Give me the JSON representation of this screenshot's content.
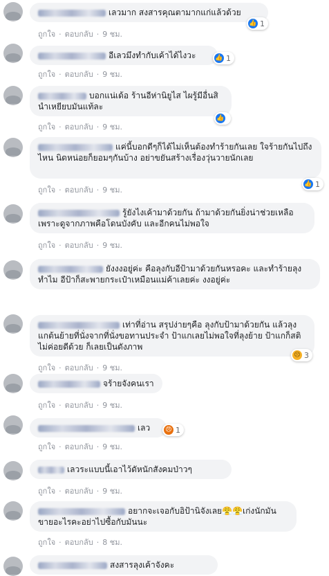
{
  "actions": {
    "like": "ถูกใจ",
    "reply": "ตอบกลับ",
    "sep": "·"
  },
  "reaction_icons": {
    "like": "thumbs-up-icon",
    "sad": "sad-face-icon",
    "angry": "angry-face-icon"
  },
  "comments": [
    {
      "text": "เลวมาก สงสารคุณตามากแก่แล้วด้วย",
      "time": "9 ชม.",
      "reaction": "like",
      "count": "1"
    },
    {
      "text": "อีเลวมึงทำกับเค้าได้ไงวะ",
      "time": "9 ชม.",
      "reaction": "like",
      "count": "1"
    },
    {
      "text": "บอกแน่เด้อ ร้านอีห่านิยูไส ไผรู้มีอื่นสินำเหยียบมันแท้ละ",
      "time": "9 ชม.",
      "reaction": "like",
      "count": ""
    },
    {
      "text": "แค่นี้บอกดีๆก็ได้ไม่เห็นต้องทำร้ายกันเลย ใจร้ายกันไปถึงไหน นิดหน่อยก็ยอมๆกันบ้าง อย่าขยันสร้างเรื่องวุ่นวายนักเลย",
      "time": "9 ชม.",
      "reaction": "like",
      "count": "1"
    },
    {
      "text": "รู้ยังไงเค้ามาด้วยกัน ถ้ามาด้วยกันยิ่งน่าช่วยเหลือ เพราะดูจากภาพคือโดนบังคับ และอีกคนไม่พอใจ",
      "time": "9 ชม.",
      "reaction": "",
      "count": ""
    },
    {
      "text": "ยังงงอยู่ค่ะ คือลุงกับอีป้ามาด้วยกันหรอคะ และทำร้ายลุงทำไม อีป้าก็สะพายกระเป๋าเหมือนแม่ค้าเลยค่ะ งงอยู่ค่ะ",
      "time": "",
      "reaction": "",
      "count": ""
    },
    {
      "text": "เท่าที่อ่าน สรุปง่ายๆคือ ลุงกับป้ามาด้วยกัน แล้วลุงแกต้นย้ายที่นั่งจากที่นั่งขอทานประจำ ป้าแกเลยไม่พอใจที่ลุงย้าย ป้าแกก็สติไม่ค่อยดีด้วย ก็เลยเป็นดังภาพ",
      "time": "9 ชม.",
      "reaction": "sad",
      "count": "3"
    },
    {
      "text": "จร้ายจังคนเรา",
      "time": "9 ชม.",
      "reaction": "",
      "count": ""
    },
    {
      "text": "เลว",
      "time": "9 ชม.",
      "reaction": "angry",
      "count": "1"
    },
    {
      "text": "เลวระแบบนี้เอาไว้ดัหนักสังคมป่าวๆ",
      "time": "9 ชม.",
      "reaction": "",
      "count": ""
    },
    {
      "text": "อยากจะเจอกับอิป้านิจังเลย😤😤เก่งนักมันขายอะไรคะอย่าไปซื้อกับมันนะ",
      "time": "8 ชม.",
      "reaction": "",
      "count": ""
    },
    {
      "text": "สงสารลุงเค้าจังคะ",
      "time": "",
      "reaction": "",
      "count": ""
    }
  ]
}
